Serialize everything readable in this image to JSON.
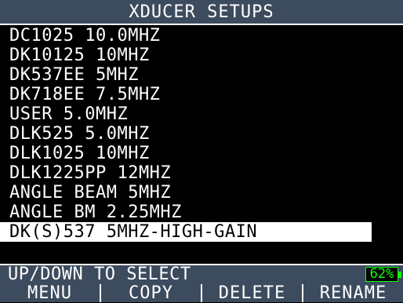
{
  "header": {
    "title": "XDUCER SETUPS"
  },
  "list": {
    "items": [
      "DC1025 10.0MHZ",
      "DK10125 10MHZ",
      "DK537EE 5MHZ",
      "DK718EE 7.5MHZ",
      "USER 5.0MHZ",
      "DLK525 5.0MHZ",
      "DLK1025 10MHZ",
      "DLK1225PP 12MHZ",
      "ANGLE BEAM 5MHZ",
      "ANGLE BM 2.25MHZ",
      "DK(S)537 5MHZ-HIGH-GAIN"
    ],
    "selected_index": 10
  },
  "status": {
    "instruction": "UP/DOWN TO SELECT",
    "battery_label": "62%",
    "battery_level": 0.62
  },
  "softkeys": [
    "MENU",
    "COPY",
    "DELETE",
    "RENAME"
  ],
  "colors": {
    "bar_background": "#3d4b5e",
    "screen_background": "#000000",
    "text": "#ffffff",
    "selection": "#ffffff",
    "battery": "#11ff11"
  }
}
